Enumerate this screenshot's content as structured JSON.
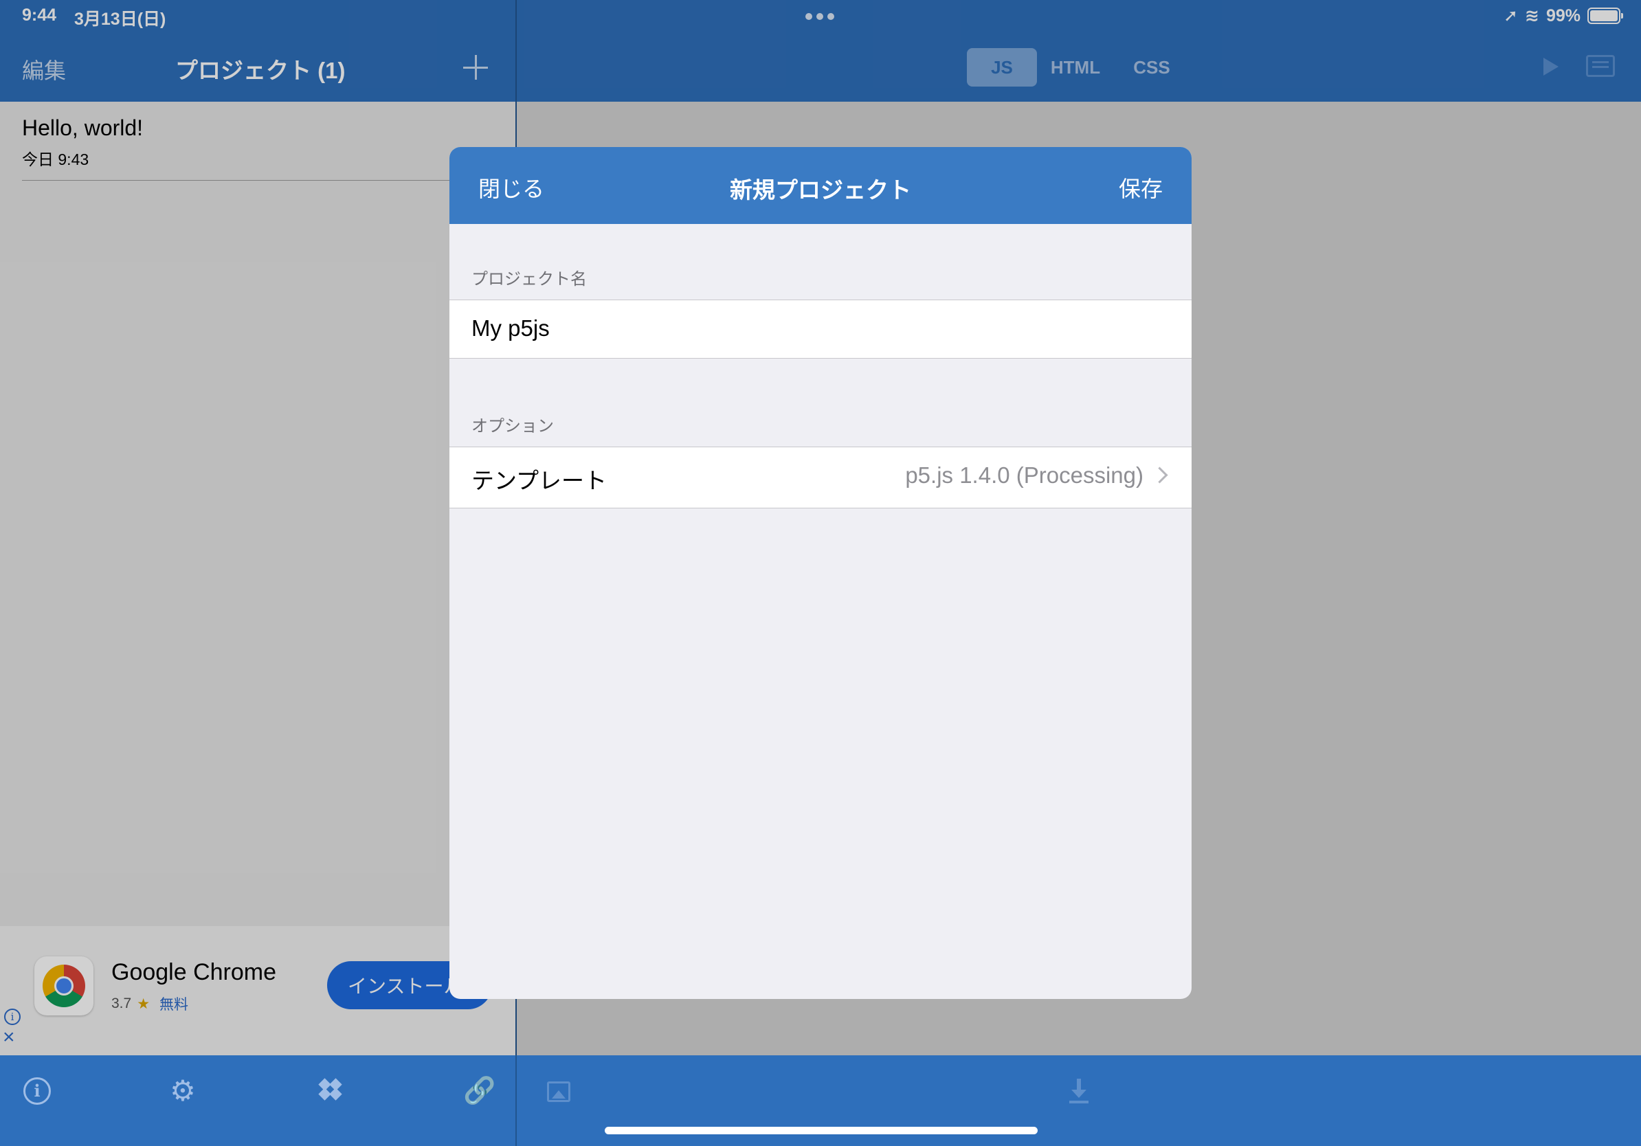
{
  "status_bar": {
    "time": "9:44",
    "date": "3月13日(日)",
    "battery": "99%"
  },
  "nav": {
    "edit_label": "編集",
    "title": "プロジェクト (1)",
    "tabs": [
      {
        "label": "JS",
        "active": true
      },
      {
        "label": "HTML",
        "active": false
      },
      {
        "label": "CSS",
        "active": false
      }
    ]
  },
  "project_list": [
    {
      "name": "Hello, world!",
      "date": "今日 9:43"
    }
  ],
  "ad": {
    "app_name": "Google Chrome",
    "rating": "3.7",
    "price": "無料",
    "install_label": "インストール"
  },
  "modal": {
    "close_label": "閉じる",
    "title": "新規プロジェクト",
    "save_label": "保存",
    "name_section": "プロジェクト名",
    "name_value": "My p5js",
    "options_section": "オプション",
    "template_label": "テンプレート",
    "template_value": "p5.js 1.4.0 (Processing)"
  },
  "icons": [
    "plus-icon",
    "play-icon",
    "keyboard-icon",
    "info-icon",
    "gear-icon",
    "dropbox-icon",
    "link-icon",
    "image-icon",
    "download-icon"
  ],
  "colors": {
    "nav_blue": "#2e6fbb",
    "modal_header": "#3a7bc4",
    "install_button": "#1e6be0"
  }
}
